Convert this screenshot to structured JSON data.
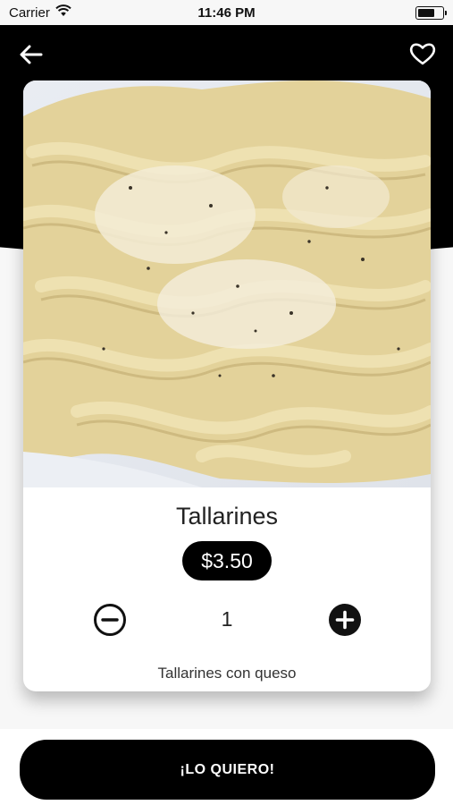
{
  "status_bar": {
    "carrier": "Carrier",
    "time": "11:46 PM",
    "icons": [
      "wifi-icon",
      "battery-icon"
    ]
  },
  "nav": {
    "back_icon": "arrow-left-icon",
    "favorite_icon": "heart-outline-icon"
  },
  "product": {
    "name": "Tallarines",
    "price": "$3.50",
    "quantity": "1",
    "description": "Tallarines con queso",
    "image": "tallarines-pasta-photo",
    "icons": {
      "decrease": "minus-circle-icon",
      "increase": "plus-circle-icon"
    }
  },
  "cta": {
    "label": "¡LO QUIERO!"
  },
  "colors": {
    "primary": "#000000",
    "background": "#f7f7f7",
    "card": "#ffffff",
    "text": "#222222"
  }
}
